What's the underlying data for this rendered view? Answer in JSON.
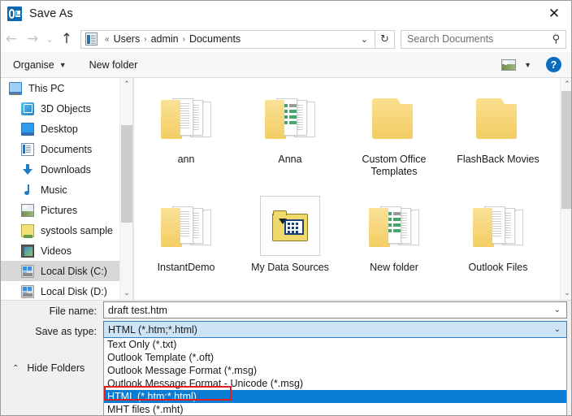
{
  "window": {
    "title": "Save As",
    "app_icon": "outlook-icon",
    "close_label": "✕"
  },
  "nav": {
    "back_icon": "←",
    "forward_icon": "→",
    "recent_icon": "⌄",
    "up_icon": "↑",
    "address_icon": "documents-icon",
    "overflow": "«",
    "crumbs": [
      "Users",
      "admin",
      "Documents"
    ],
    "separator": "›",
    "dropdown_caret": "⌄",
    "refresh_icon": "↻"
  },
  "search": {
    "placeholder": "Search Documents",
    "icon": "⚲"
  },
  "commandbar": {
    "organise_label": "Organise",
    "organise_caret": "▼",
    "new_folder_label": "New folder",
    "view_caret": "▼",
    "help_label": "?"
  },
  "sidebar": {
    "items": [
      {
        "label": "This PC",
        "icon": "monitor-icon",
        "indent": false,
        "selected": false
      },
      {
        "label": "3D Objects",
        "icon": "cube-icon",
        "indent": true,
        "selected": false
      },
      {
        "label": "Desktop",
        "icon": "desktop-icon",
        "indent": true,
        "selected": false
      },
      {
        "label": "Documents",
        "icon": "document-icon",
        "indent": true,
        "selected": false
      },
      {
        "label": "Downloads",
        "icon": "download-icon",
        "indent": true,
        "selected": false
      },
      {
        "label": "Music",
        "icon": "music-icon",
        "indent": true,
        "selected": false
      },
      {
        "label": "Pictures",
        "icon": "picture-icon",
        "indent": true,
        "selected": false
      },
      {
        "label": "systools sample",
        "icon": "folder-icon",
        "indent": true,
        "selected": false
      },
      {
        "label": "Videos",
        "icon": "video-icon",
        "indent": true,
        "selected": false
      },
      {
        "label": "Local Disk (C:)",
        "icon": "disk-icon",
        "indent": true,
        "selected": true
      },
      {
        "label": "Local Disk (D:)",
        "icon": "disk-icon",
        "indent": true,
        "selected": false
      }
    ],
    "scroll_up_icon": "⌃",
    "scroll_down_icon": "⌄"
  },
  "files": {
    "scroll_up_icon": "⌃",
    "scroll_down_icon": "⌄",
    "rows": [
      [
        {
          "name": "ann",
          "icon": "folder-with-document",
          "selected": false
        },
        {
          "name": "Anna",
          "icon": "folder-with-spreadsheet",
          "selected": false
        },
        {
          "name": "Custom Office Templates",
          "icon": "folder-empty",
          "selected": false
        },
        {
          "name": "FlashBack Movies",
          "icon": "folder-empty",
          "selected": false
        }
      ],
      [
        {
          "name": "InstantDemo",
          "icon": "folder-with-document",
          "selected": false
        },
        {
          "name": "My Data Sources",
          "icon": "data-sources-folder",
          "selected": true
        },
        {
          "name": "New folder",
          "icon": "folder-with-spreadsheet",
          "selected": false
        },
        {
          "name": "Outlook Files",
          "icon": "folder-with-document",
          "selected": false
        }
      ]
    ]
  },
  "form": {
    "filename_label": "File name:",
    "filename_value": "draft test.htm",
    "filename_caret": "⌄",
    "savetype_label": "Save as type:",
    "savetype_value": "HTML (*.htm;*.html)",
    "savetype_caret": "⌄",
    "hide_folders_label": "Hide Folders",
    "hide_folders_chevron": "⌃"
  },
  "dropdown": {
    "options": [
      {
        "label": "Text Only (*.txt)",
        "selected": false
      },
      {
        "label": "Outlook Template (*.oft)",
        "selected": false
      },
      {
        "label": "Outlook Message Format (*.msg)",
        "selected": false
      },
      {
        "label": "Outlook Message Format - Unicode (*.msg)",
        "selected": false
      },
      {
        "label": "HTML (*.htm;*.html)",
        "selected": true
      },
      {
        "label": "MHT files (*.mht)",
        "selected": false
      }
    ]
  },
  "colors": {
    "accent_blue": "#0a7cd4",
    "combo_fill": "#cde4f7",
    "annotation_red": "#e02020",
    "selection_gray": "#d8d8d8"
  }
}
